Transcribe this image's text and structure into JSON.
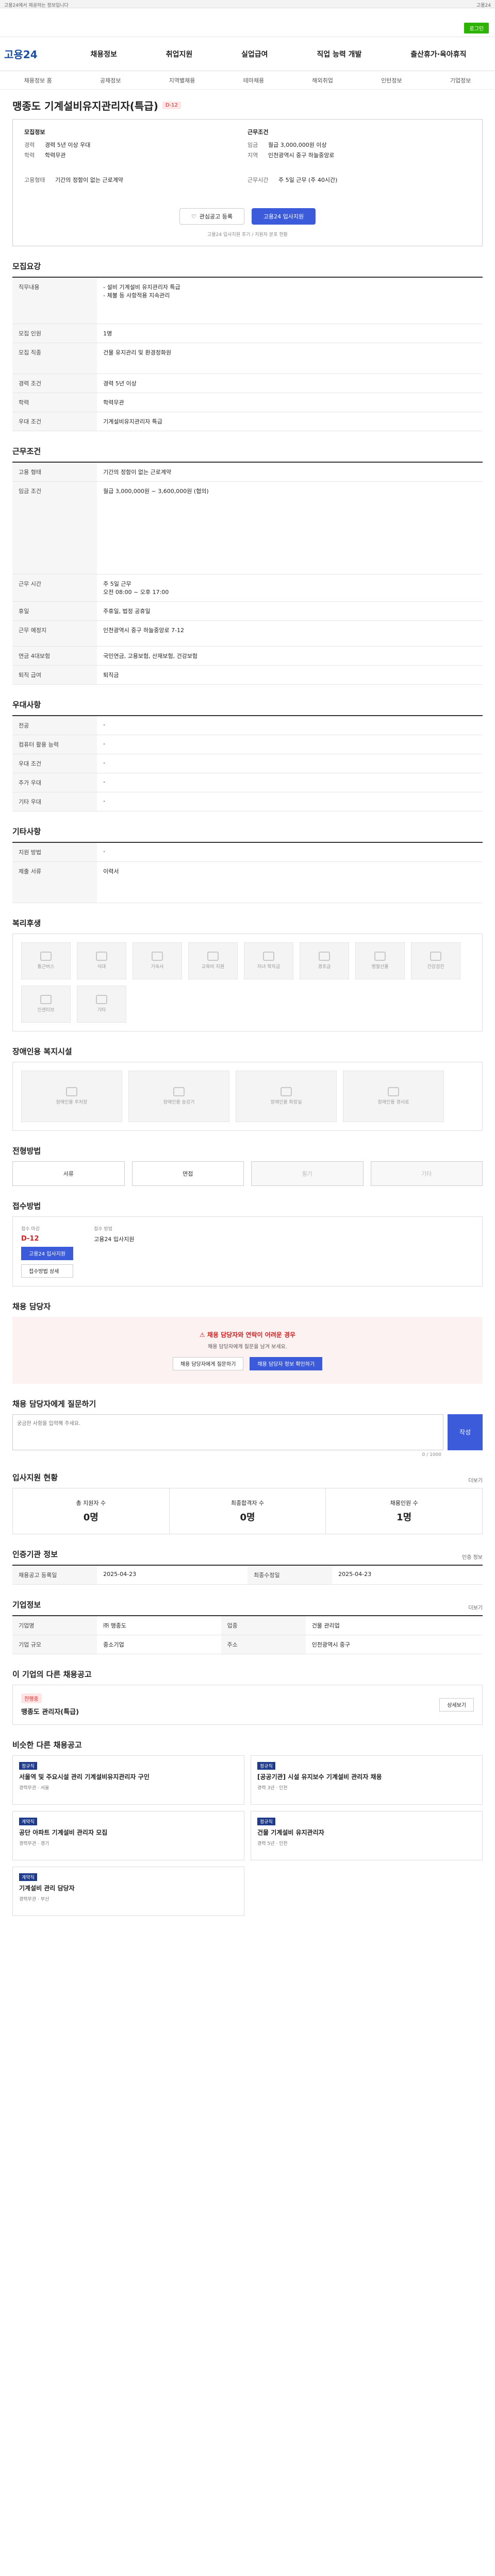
{
  "topbar": {
    "left": "고용24에서 제공하는 정보입니다",
    "right": "고용24"
  },
  "header": {
    "login": "로그인"
  },
  "gnb": {
    "logo": "고용24",
    "menu": [
      "채용정보",
      "취업지원",
      "실업급여",
      "직업 능력 개발",
      "출산휴가·육아휴직"
    ]
  },
  "lnb": [
    "채용정보 홈",
    "공채정보",
    "지역별채용",
    "테마채용",
    "해외취업",
    "인턴정보",
    "기업정보"
  ],
  "job": {
    "title": "맹종도 기계설비유지관리자(특급)",
    "badge": "D-12",
    "company_h": "모집정보",
    "recruit_h": "근무조건",
    "career_label": "경력",
    "career": "경력 5년 이상 우대",
    "edu_label": "학력",
    "edu": "학력무관",
    "hire_label": "고용형태",
    "hire": "기간의 정함이 없는 근로계약",
    "pay_label": "임금",
    "pay": "월급 3,000,000원 이상",
    "loc_label": "지역",
    "loc": "인천광역시 중구 하늘중앙로",
    "time_label": "근무시간",
    "time": "주 5일 근무 (주 40시간)",
    "apply_btn": "관심공고 등록",
    "primary_btn": "고용24 입사지원",
    "note": "고용24 입사지원 후기 / 지원자 분포 현황"
  },
  "section_recruit": {
    "title": "모집요강",
    "rows": [
      [
        "직무내용",
        "- 설비 기계설비 유지관리자 특급\n- 체불 등 사항적용 지속관리"
      ],
      [
        "모집 인원",
        "1명"
      ],
      [
        "모집 직종",
        "건물 유지관리 및 환경정화원"
      ],
      [
        "경력 조건",
        "경력 5년 이상"
      ],
      [
        "학력",
        "학력무관"
      ],
      [
        "우대 조건",
        "기계설비유지관리자 특급"
      ]
    ]
  },
  "section_work": {
    "title": "근무조건",
    "rows": [
      [
        "고용 형태",
        "기간의 정함이 없는 근로계약"
      ],
      [
        "임금 조건",
        "월급 3,000,000원 ~ 3,600,000원 (협의)"
      ],
      [
        "근무 시간",
        "주 5일 근무\n오전 08:00 ~ 오후 17:00"
      ],
      [
        "휴일",
        "주휴일, 법정 공휴일"
      ],
      [
        "근무 예정지",
        "인천광역시 중구 하늘중앙로 7-12"
      ],
      [
        "연금 4대보험",
        "국민연금, 고용보험, 산재보험, 건강보험"
      ],
      [
        "퇴직 급여",
        "퇴직금"
      ]
    ]
  },
  "section_welfare": {
    "title": "우대사항",
    "rows": [
      [
        "전공",
        "-"
      ],
      [
        "컴퓨터 활용 능력",
        "-"
      ],
      [
        "우대 조건",
        "-"
      ],
      [
        "추가 우대",
        "-"
      ],
      [
        "기타 우대",
        "-"
      ]
    ]
  },
  "section_other": {
    "title": "기타사항",
    "rows": [
      [
        "지원 방법",
        "-"
      ],
      [
        "제출 서류",
        "이력서"
      ]
    ]
  },
  "section_benefits": {
    "title": "복리후생",
    "items": [
      "통근버스",
      "식대",
      "기숙사",
      "교육비 지원",
      "자녀 학자금",
      "경조금",
      "명절선물",
      "건강검진",
      "인센티브",
      "기타"
    ]
  },
  "section_disabled": {
    "title": "장애인용 복지시설",
    "items": [
      "장애인용 주차장",
      "장애인용 승강기",
      "장애인용 화장실",
      "장애인용 경사로"
    ]
  },
  "section_method": {
    "title": "전형방법",
    "items": [
      "서류",
      "면접",
      "필기",
      "기타"
    ]
  },
  "section_apply": {
    "title": "접수방법",
    "dday_label": "접수 마감",
    "dday": "D-12",
    "method_label": "접수 방법",
    "method": "고용24 입사지원",
    "btn1": "고용24 입사지원",
    "btn2": "접수방법 상세"
  },
  "section_chat": {
    "title": "채용 담당자",
    "hd": "채용 담당자와 연락이 어려운 경우",
    "p": "채용 담당자에게 질문을 남겨 보세요.",
    "b1": "채용 담당자에게 질문하기",
    "b2": "채용 담당자 정보 확인하기"
  },
  "section_qa": {
    "title": "채용 담당자에게 질문하기",
    "placeholder": "궁금한 사항을 입력해 주세요.",
    "submit": "작성",
    "count": "0 / 1000"
  },
  "section_stats": {
    "title": "입사지원 현황",
    "more": "더보기",
    "items": [
      [
        "총 지원자 수",
        "0명"
      ],
      [
        "최종합격자 수",
        "0명"
      ],
      [
        "채용인원 수",
        "1명"
      ]
    ]
  },
  "section_contact": {
    "title": "인증기관 정보",
    "more": "인증 정보",
    "rows": [
      [
        "채용공고 등록일",
        "2025-04-23"
      ],
      [
        "최종수정일",
        "2025-04-23"
      ]
    ]
  },
  "section_company": {
    "title": "기업정보",
    "more": "더보기",
    "rows": [
      [
        "기업명",
        "㈜ 맹종도"
      ],
      [
        "업종",
        "건물 관리업"
      ],
      [
        "기업 규모",
        "중소기업"
      ],
      [
        "주소",
        "인천광역시 중구"
      ]
    ]
  },
  "section_related": {
    "title": "이 기업의 다른 채용공고",
    "job": "맹종도 관리자(특급)",
    "tag": "진행중",
    "btn": "상세보기"
  },
  "section_recommend": {
    "title": "비슷한 다른 채용공고",
    "cards": [
      {
        "tag": "정규직",
        "title": "서울역 및 주요시설 관리 기계설비유지관리자 구인",
        "sub": "경력무관 · 서울"
      },
      {
        "tag": "정규직",
        "title": "[공공기관] 시설 유지보수 기계설비 관리자 채용",
        "sub": "경력 3년 · 인천"
      },
      {
        "tag": "계약직",
        "title": "공단 아파트 기계설비 관리자 모집",
        "sub": "경력무관 · 경기"
      },
      {
        "tag": "정규직",
        "title": "건물 기계설비 유지관리자",
        "sub": "경력 5년 · 인천"
      },
      {
        "tag": "계약직",
        "title": "기계설비 관리 담당자",
        "sub": "경력무관 · 부산"
      }
    ]
  }
}
